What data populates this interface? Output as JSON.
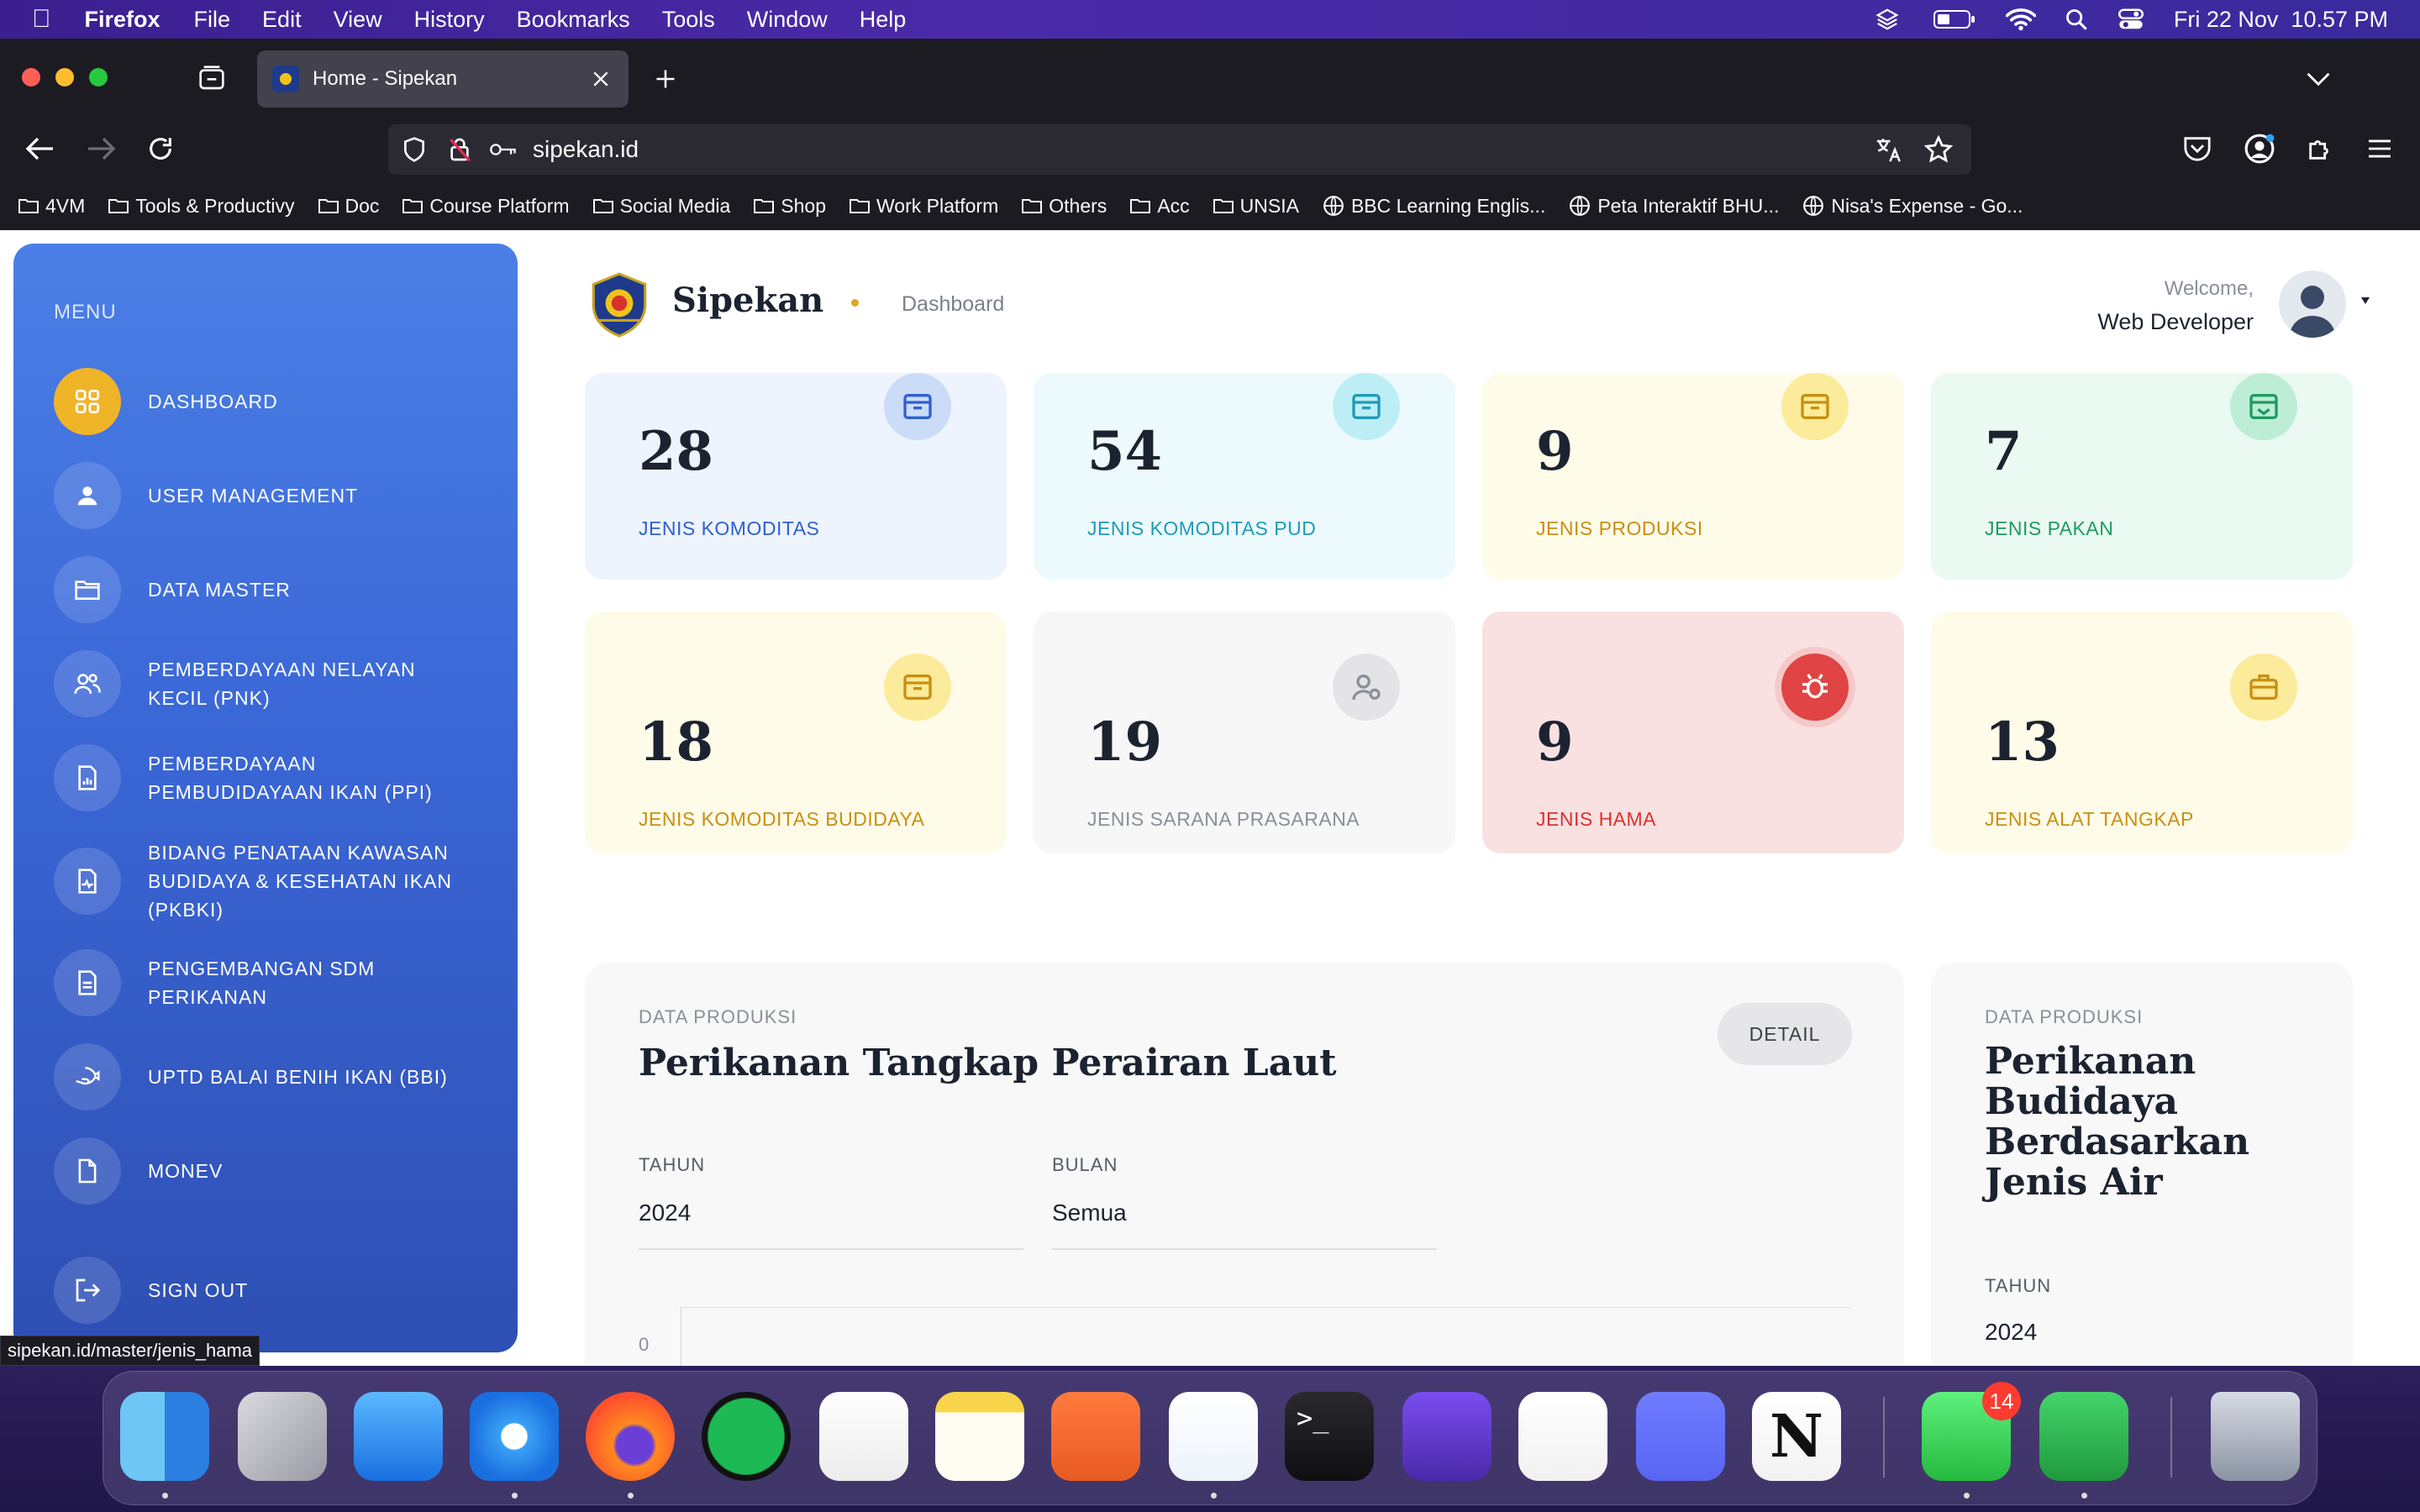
{
  "menubar": {
    "app": "Firefox",
    "items": [
      "File",
      "Edit",
      "View",
      "History",
      "Bookmarks",
      "Tools",
      "Window",
      "Help"
    ],
    "datetime": "Fri 22 Nov  10.57 PM"
  },
  "browser": {
    "tab_title": "Home - Sipekan",
    "url": "sipekan.id",
    "bookmarks": [
      "4VM",
      "Tools & Productivy",
      "Doc",
      "Course Platform",
      "Social Media",
      "Shop",
      "Work Platform",
      "Others",
      "Acc",
      "UNSIA"
    ],
    "bookmark_links": [
      "BBC Learning Englis...",
      "Peta Interaktif BHU...",
      "Nisa's Expense - Go..."
    ],
    "status_url": "sipekan.id/master/jenis_hama"
  },
  "sidebar": {
    "menu_label": "MENU",
    "items": [
      {
        "label": "DASHBOARD",
        "icon": "dashboard-icon"
      },
      {
        "label": "USER MANAGEMENT",
        "icon": "user-icon"
      },
      {
        "label": "DATA MASTER",
        "icon": "folder-icon"
      },
      {
        "label": "PEMBERDAYAAN NELAYAN KECIL (PNK)",
        "icon": "users-icon"
      },
      {
        "label": "PEMBERDAYAAN PEMBUDIDAYAAN IKAN (PPI)",
        "icon": "report-icon"
      },
      {
        "label": "BIDANG PENATAAN KAWASAN BUDIDAYA & KESEHATAN IKAN (PKBKI)",
        "icon": "health-doc-icon"
      },
      {
        "label": "PENGEMBANGAN SDM PERIKANAN",
        "icon": "document-icon"
      },
      {
        "label": "UPTD BALAI BENIH IKAN (BBI)",
        "icon": "fish-hand-icon"
      },
      {
        "label": "MONEV",
        "icon": "file-icon"
      }
    ],
    "signout": "SIGN OUT"
  },
  "header": {
    "brand": "Sipekan",
    "breadcrumb": "Dashboard",
    "welcome": "Welcome,",
    "user": "Web Developer"
  },
  "stats": [
    {
      "value": "28",
      "label": "JENIS KOMODITAS",
      "bg": "#eef4fd",
      "accent": "#2f5fd0",
      "iconbg": "#cbdcf8"
    },
    {
      "value": "54",
      "label": "JENIS KOMODITAS PUD",
      "bg": "#ecfafd",
      "accent": "#1f9bb8",
      "iconbg": "#bdeef6"
    },
    {
      "value": "9",
      "label": "JENIS PRODUKSI",
      "bg": "#fefbe9",
      "accent": "#c98f12",
      "iconbg": "#fbeb9a"
    },
    {
      "value": "7",
      "label": "JENIS PAKAN",
      "bg": "#eaf9f1",
      "accent": "#1f9a63",
      "iconbg": "#bdeed5"
    },
    {
      "value": "18",
      "label": "JENIS KOMODITAS BUDIDAYA",
      "bg": "#fefbe9",
      "accent": "#c98f12",
      "iconbg": "#fbeb9a"
    },
    {
      "value": "19",
      "label": "JENIS SARANA PRASARANA",
      "bg": "#f7f7f7",
      "accent": "#8a8f99",
      "iconbg": "#e4e4e6"
    },
    {
      "value": "9",
      "label": "JENIS HAMA",
      "bg": "#fae1e1",
      "accent": "#d8322f",
      "iconbg": "#e04444"
    },
    {
      "value": "13",
      "label": "JENIS ALAT TANGKAP",
      "bg": "#fefbe9",
      "accent": "#c98f12",
      "iconbg": "#fbeb9a"
    }
  ],
  "panel_main": {
    "caption": "DATA PRODUKSI",
    "title": "Perikanan Tangkap Perairan Laut",
    "detail": "DETAIL",
    "tahun_label": "TAHUN",
    "tahun": "2024",
    "bulan_label": "BULAN",
    "bulan": "Semua",
    "axis_zero": "0"
  },
  "panel_side": {
    "caption": "DATA PRODUKSI",
    "title_lines": [
      "Perikanan",
      "Budidaya",
      "Berdasarkan",
      "Jenis Air"
    ],
    "tahun_label": "TAHUN",
    "tahun": "2024"
  },
  "dock": {
    "whatsapp_badge": "14",
    "apps": [
      "Finder",
      "Launchpad",
      "Mail",
      "Safari",
      "Firefox",
      "Spotify",
      "Reminders",
      "Notes",
      "Postman",
      "Visual Studio Code",
      "Terminal",
      "DBeaver",
      "TablePlus",
      "Discord",
      "Notion",
      "WhatsApp",
      "Numbers",
      "Trash"
    ]
  }
}
